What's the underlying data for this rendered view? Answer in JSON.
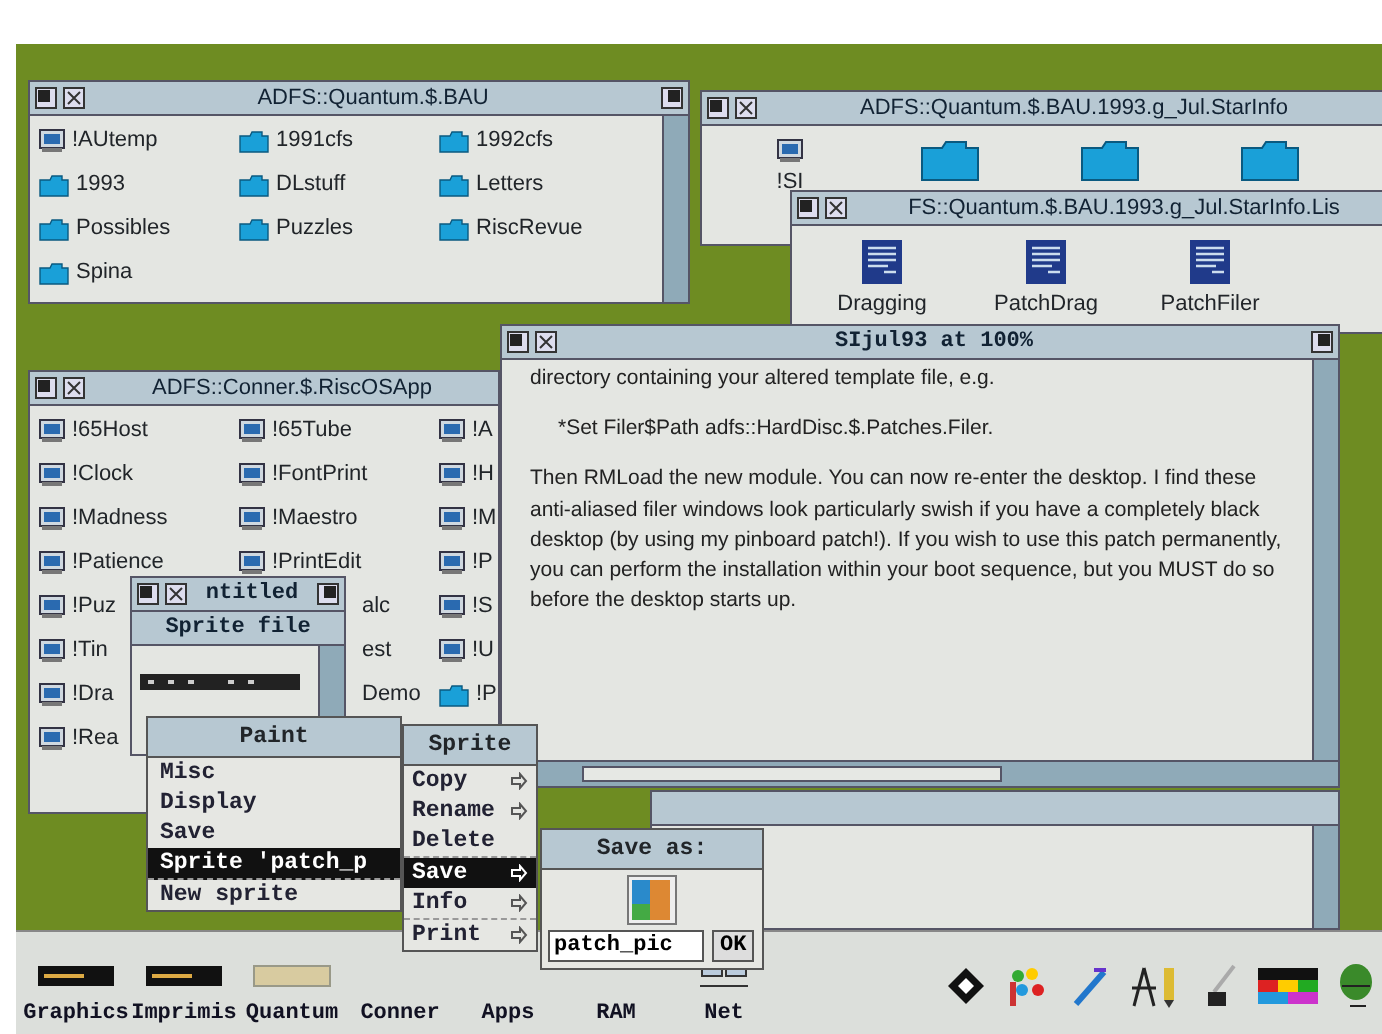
{
  "filer_windows": [
    {
      "title": "ADFS::Quantum.$.BAU",
      "items": [
        {
          "label": "!AUtemp",
          "kind": "app"
        },
        {
          "label": "1991cfs",
          "kind": "folder"
        },
        {
          "label": "1992cfs",
          "kind": "folder"
        },
        {
          "label": "1993",
          "kind": "folder"
        },
        {
          "label": "DLstuff",
          "kind": "folder"
        },
        {
          "label": "Letters",
          "kind": "folder"
        },
        {
          "label": "Possibles",
          "kind": "folder"
        },
        {
          "label": "Puzzles",
          "kind": "folder"
        },
        {
          "label": "RiscRevue",
          "kind": "folder"
        },
        {
          "label": "Spina",
          "kind": "folder"
        }
      ]
    },
    {
      "title": "ADFS::Quantum.$.BAU.1993.g_Jul.StarInfo",
      "items": [
        {
          "label": "!SI",
          "kind": "app"
        },
        {
          "kind": "folder"
        },
        {
          "kind": "folder"
        },
        {
          "kind": "folder"
        }
      ]
    },
    {
      "title": "FS::Quantum.$.BAU.1993.g_Jul.StarInfo.Lis",
      "items": [
        {
          "label": "Dragging",
          "kind": "document"
        },
        {
          "label": "PatchDrag",
          "kind": "document"
        },
        {
          "label": "PatchFiler",
          "kind": "document"
        }
      ]
    },
    {
      "title": "ADFS::Conner.$.RiscOSApp",
      "items": [
        {
          "label": "!65Host",
          "kind": "app"
        },
        {
          "label": "!65Tube",
          "kind": "app"
        },
        {
          "label": "!A",
          "kind": "app"
        },
        {
          "label": "!Clock",
          "kind": "app"
        },
        {
          "label": "!FontPrint",
          "kind": "app"
        },
        {
          "label": "!H",
          "kind": "app"
        },
        {
          "label": "!Madness",
          "kind": "app"
        },
        {
          "label": "!Maestro",
          "kind": "app"
        },
        {
          "label": "!M",
          "kind": "app"
        },
        {
          "label": "!Patience",
          "kind": "app"
        },
        {
          "label": "!PrintEdit",
          "kind": "app"
        },
        {
          "label": "!P",
          "kind": "app"
        },
        {
          "label": "!Puz",
          "kind": "app"
        },
        {
          "label": "alc",
          "kind": "covered"
        },
        {
          "label": "!S",
          "kind": "app"
        },
        {
          "label": "!Tin",
          "kind": "app"
        },
        {
          "label": "est",
          "kind": "covered"
        },
        {
          "label": "!U",
          "kind": "app"
        },
        {
          "label": "!Dra",
          "kind": "app"
        },
        {
          "label": "Demo",
          "kind": "covered"
        },
        {
          "label": "!P",
          "kind": "folder"
        },
        {
          "label": "!Rea",
          "kind": "app"
        }
      ]
    }
  ],
  "text_window": {
    "title": "SIjul93 at 100%",
    "paragraphs": [
      "directory containing your altered template file, e.g.",
      "*Set Filer$Path adfs::HardDisc.$.Patches.Filer.",
      "Then RMLoad the new module. You can now re-enter the desktop. I find these anti-aliased filer windows look particularly swish if you have a completely black desktop (by using my pinboard patch!). If you wish to use this patch permanently, you can perform the installation within your boot sequence, but you MUST do so before the desktop starts up."
    ]
  },
  "sprite_window": {
    "title": "ntitled",
    "heading": "Sprite file"
  },
  "paint_menu": {
    "title": "Paint",
    "items": [
      {
        "label": "Misc",
        "selected": false,
        "submenu": false,
        "separator_after": false
      },
      {
        "label": "Display",
        "selected": false,
        "submenu": false,
        "separator_after": false
      },
      {
        "label": "Save",
        "selected": false,
        "submenu": false,
        "separator_after": false
      },
      {
        "label": "Sprite 'patch_p",
        "selected": true,
        "submenu": false,
        "separator_after": true
      },
      {
        "label": "New sprite",
        "selected": false,
        "submenu": false,
        "separator_after": false
      }
    ]
  },
  "sprite_menu": {
    "title": "Sprite",
    "items": [
      {
        "label": "Copy",
        "selected": false,
        "submenu": true,
        "separator_after": false
      },
      {
        "label": "Rename",
        "selected": false,
        "submenu": true,
        "separator_after": false
      },
      {
        "label": "Delete",
        "selected": false,
        "submenu": false,
        "separator_after": true
      },
      {
        "label": "Save",
        "selected": true,
        "submenu": true,
        "separator_after": false
      },
      {
        "label": "Info",
        "selected": false,
        "submenu": true,
        "separator_after": true
      },
      {
        "label": "Print",
        "selected": false,
        "submenu": true,
        "separator_after": false
      }
    ]
  },
  "save_dialog": {
    "title": "Save as:",
    "filename": "patch_pic",
    "button": "OK"
  },
  "icon_bar": {
    "devices": [
      {
        "label": "Graphics",
        "kind": "harddisc"
      },
      {
        "label": "Imprimis",
        "kind": "harddisc"
      },
      {
        "label": "Quantum",
        "kind": "disc"
      },
      {
        "label": "Conner",
        "kind": "hidden"
      },
      {
        "label": "Apps",
        "kind": "hidden"
      },
      {
        "label": "RAM",
        "kind": "hidden"
      },
      {
        "label": "Net",
        "kind": "network"
      }
    ],
    "apps": [
      {
        "kind": "diamond"
      },
      {
        "kind": "palette"
      },
      {
        "kind": "brush"
      },
      {
        "kind": "compass"
      },
      {
        "kind": "quill"
      },
      {
        "kind": "blocks"
      },
      {
        "kind": "globe"
      }
    ]
  }
}
